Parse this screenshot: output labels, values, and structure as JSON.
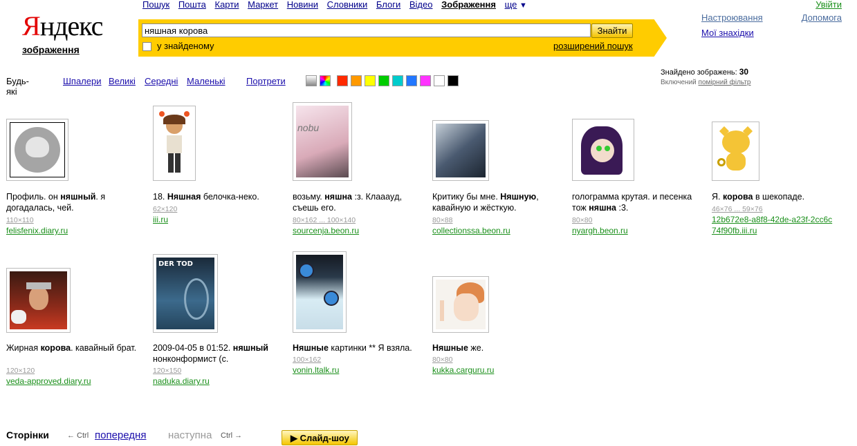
{
  "topnav": {
    "items": [
      {
        "label": "Пошук"
      },
      {
        "label": "Пошта"
      },
      {
        "label": "Карти"
      },
      {
        "label": "Маркет"
      },
      {
        "label": "Новини"
      },
      {
        "label": "Словники"
      },
      {
        "label": "Блоги"
      },
      {
        "label": "Відео"
      },
      {
        "label": "Зображення",
        "current": true
      }
    ],
    "more_label": "ще",
    "login_label": "Увійти"
  },
  "logo": {
    "brand_first": "Я",
    "brand_rest": "ндекс",
    "subtitle": "зображення"
  },
  "search": {
    "query": "няшная корова",
    "button_label": "Знайти",
    "in_found_label": "у знайденому",
    "advanced_label": "розширений пошук"
  },
  "header_links": {
    "settings": "Настроювання",
    "help": "Допомога",
    "my_finds": "Мої знахідки"
  },
  "filters": {
    "any": "Будь-які",
    "sizes": [
      "Шпалери",
      "Великі",
      "Середні",
      "Маленькі"
    ],
    "portraits": "Портрети",
    "colors": [
      "#999999",
      "multicolor",
      "#ff2a00",
      "#ff9900",
      "#ffff00",
      "#00cc00",
      "#00cccc",
      "#2277ff",
      "#ff33ff",
      "#ffffff",
      "#000000"
    ]
  },
  "results_info": {
    "found_label": "Знайдено зображень:",
    "found_count": "30",
    "filter_prefix": "Включений",
    "filter_link": "помірний фільтр"
  },
  "results": [
    {
      "caption_pre": "Профиль. он ",
      "caption_bold": "няшный",
      "caption_post": ". я догадалась, чей.",
      "size": "110×110",
      "source": "felisfenix.diary.ru"
    },
    {
      "caption_pre": "18. ",
      "caption_bold": "Няшная",
      "caption_post": " белочка-неко.",
      "size": "62×120",
      "source": "iii.ru"
    },
    {
      "caption_pre": "возьму. ",
      "caption_bold": "няшна",
      "caption_post": " :з. Клаааyд, съешь его.",
      "size": "80×162 ... 100×140",
      "source": "sourcenja.beon.ru"
    },
    {
      "caption_pre": "Критику бы мне. ",
      "caption_bold": "Няшную",
      "caption_post": ", кавайную и жёсткую.",
      "size": "80×88",
      "source": "collectionssa.beon.ru"
    },
    {
      "caption_pre": "голограмма крутая. и песенка тож ",
      "caption_bold": "няшна",
      "caption_post": " :3.",
      "size": "80×80",
      "source": "nyargh.beon.ru"
    },
    {
      "caption_pre": "Я. ",
      "caption_bold": "корова",
      "caption_post": " в шекопаде.",
      "size": "46×76 ... 59×76",
      "source": "12b672e8-a8f8-42de-a23f-2cc6c74f90fb.iii.ru"
    },
    {
      "caption_pre": "Жирная ",
      "caption_bold": "корова",
      "caption_post": ". кавайный брат.",
      "size": "120×120",
      "source": "veda-approved.diary.ru"
    },
    {
      "caption_pre": "2009-04-05 в 01:52. ",
      "caption_bold": "няшный",
      "caption_post": " нонконформист (с.",
      "size": "120×150",
      "source": "naduka.diary.ru",
      "thumb_text": "DER TOD"
    },
    {
      "caption_pre": "",
      "caption_bold": "Няшные",
      "caption_post": " картинки ** Я взяла.",
      "size": "100×162",
      "source": "vonin.ltalk.ru"
    },
    {
      "caption_pre": "",
      "caption_bold": "Няшные",
      "caption_post": " же.",
      "size": "80×80",
      "source": "kukka.carguru.ru"
    }
  ],
  "pager": {
    "title": "Сторінки",
    "prev_ctrl": "← Ctrl",
    "prev_label": "попередня",
    "next_label": "наступна",
    "next_ctrl": "Ctrl →",
    "slideshow_label": "Слайд-шоу"
  }
}
